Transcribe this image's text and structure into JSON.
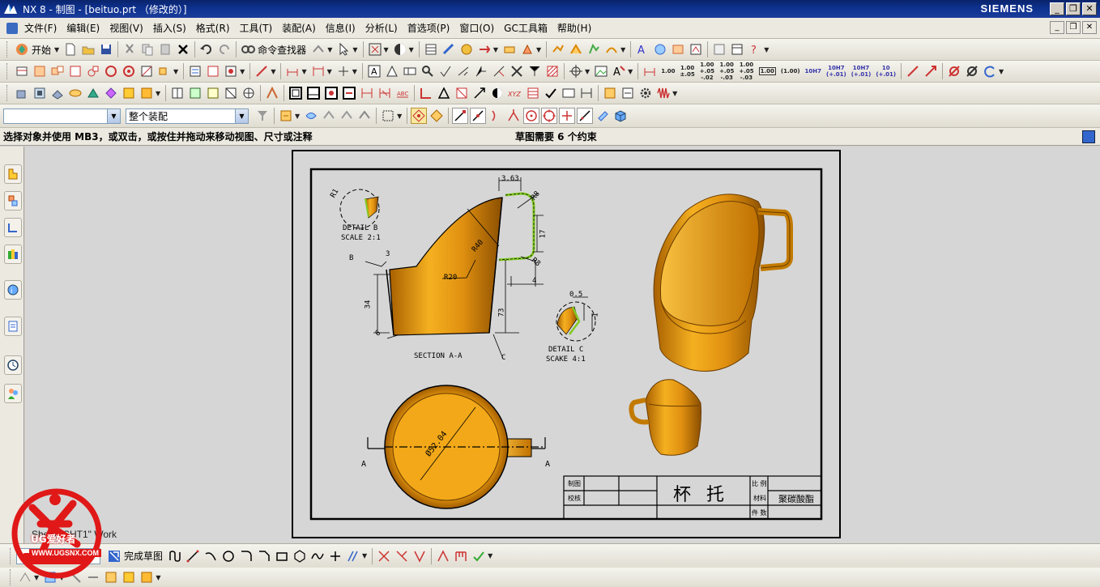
{
  "window": {
    "title": "NX 8 - 制图 - [beituo.prt （修改的）]",
    "brand": "SIEMENS",
    "minimize": "_",
    "restore": "❐",
    "close": "✕"
  },
  "menu": {
    "items": [
      "文件(F)",
      "编辑(E)",
      "视图(V)",
      "插入(S)",
      "格式(R)",
      "工具(T)",
      "装配(A)",
      "信息(I)",
      "分析(L)",
      "首选项(P)",
      "窗口(O)",
      "GC工具箱",
      "帮助(H)"
    ]
  },
  "toolbar1": {
    "start_label": "开始",
    "command_finder_label": "命令查找器"
  },
  "toolbar2": {
    "dim_labels": [
      "1.00",
      "1.00\n±.05",
      "1.00\n+.05\n-.02",
      "1.00\n+.05\n-.03",
      "1.00\n+.05\n-.03",
      "1.00",
      "(1.00)",
      "10H7",
      "10H7\n(+.01)",
      "10H7\n(+.01)",
      "10\n(+.01)"
    ]
  },
  "toolbar4": {
    "selection_filter_value": "",
    "scope_value": "整个装配"
  },
  "status": {
    "prompt": "选择对象并使用 MB3，或双击，或按住并拖动来移动视图、尺寸或注释",
    "sketch_status": "草图需要 6 个约束"
  },
  "drawing": {
    "sheet_label": "Sheet \"SHT1\" Work",
    "section_label": "SECTION A-A",
    "detail_b_label": "DETAIL B",
    "detail_b_scale": "SCALE 2:1",
    "detail_c_label": "DETAIL C",
    "detail_c_scale": "SCAKE 4:1",
    "dims": {
      "d363": "3.63",
      "r8a": "R8",
      "r8b": "R8",
      "d17": "17",
      "d4": "4",
      "r40": "R40",
      "r20": "R20",
      "d3": "3",
      "d34": "34",
      "d73": "73",
      "d6": "6",
      "r1": "R1",
      "d05": "0.5",
      "d1": "1",
      "phi": "Ø52.04"
    },
    "marks": {
      "a_left": "A",
      "a_right": "A",
      "b_mark": "B",
      "c_mark": "C"
    },
    "titleblock": {
      "made_by": "制图",
      "checked_by": "校核",
      "part_name": "杯  托",
      "scale": "比 例",
      "material": "材料",
      "material_value": "聚碳酸酯",
      "weight": "件 数"
    }
  },
  "sketch_toolbar": {
    "finish_label": "完成草图"
  },
  "watermark": {
    "brand": "UG爱好者",
    "url": "WWW.UGSNX.COM"
  },
  "colors": {
    "part_orange": "#f0a20a",
    "part_dark": "#b86c00",
    "titlebar_blue": "#0a246a",
    "canvas_gray": "#d6d6d6",
    "sketch_green": "#80c820"
  }
}
